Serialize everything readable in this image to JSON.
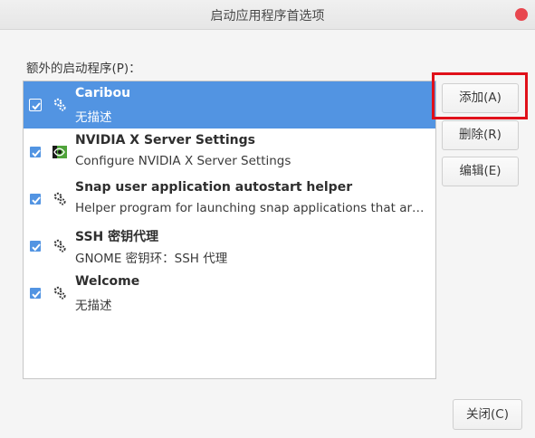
{
  "window": {
    "title": "启动应用程序首选项",
    "close_icon": "close-icon",
    "close_color": "#e8474f"
  },
  "section_label": "额外的启动程序(P)：",
  "colors": {
    "selection": "#5294e2",
    "highlight_border": "#e0101a"
  },
  "programs": [
    {
      "name": "Caribou",
      "description": "无描述",
      "checked": true,
      "selected": true,
      "icon": "gear-icon"
    },
    {
      "name": "NVIDIA X Server Settings",
      "description": "Configure NVIDIA X Server Settings",
      "checked": true,
      "selected": false,
      "icon": "nvidia-icon"
    },
    {
      "name": "Snap user application autostart helper",
      "description": "Helper program for launching snap applications that ar…",
      "checked": true,
      "selected": false,
      "icon": "gear-icon"
    },
    {
      "name": "SSH 密钥代理",
      "description": "GNOME 密钥环：SSH 代理",
      "checked": true,
      "selected": false,
      "icon": "gear-icon"
    },
    {
      "name": "Welcome",
      "description": "无描述",
      "checked": true,
      "selected": false,
      "icon": "gear-icon"
    }
  ],
  "buttons": {
    "add": "添加(A)",
    "remove": "删除(R)",
    "edit": "编辑(E)",
    "close": "关闭(C)"
  }
}
